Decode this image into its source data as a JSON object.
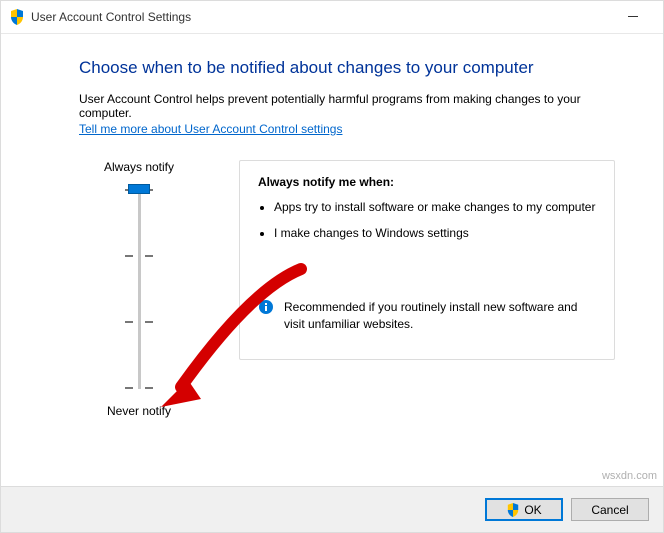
{
  "window": {
    "title": "User Account Control Settings"
  },
  "main": {
    "heading": "Choose when to be notified about changes to your computer",
    "subtext": "User Account Control helps prevent potentially harmful programs from making changes to your computer.",
    "link": "Tell me more about User Account Control settings"
  },
  "slider": {
    "top_label": "Always notify",
    "bottom_label": "Never notify",
    "levels": 4,
    "current_level": 4
  },
  "info": {
    "title": "Always notify me when:",
    "bullet1": "Apps try to install software or make changes to my computer",
    "bullet2": "I make changes to Windows settings",
    "recommended": "Recommended if you routinely install new software and visit unfamiliar websites."
  },
  "footer": {
    "ok_label": "OK",
    "cancel_label": "Cancel"
  },
  "watermark": "wsxdn.com"
}
